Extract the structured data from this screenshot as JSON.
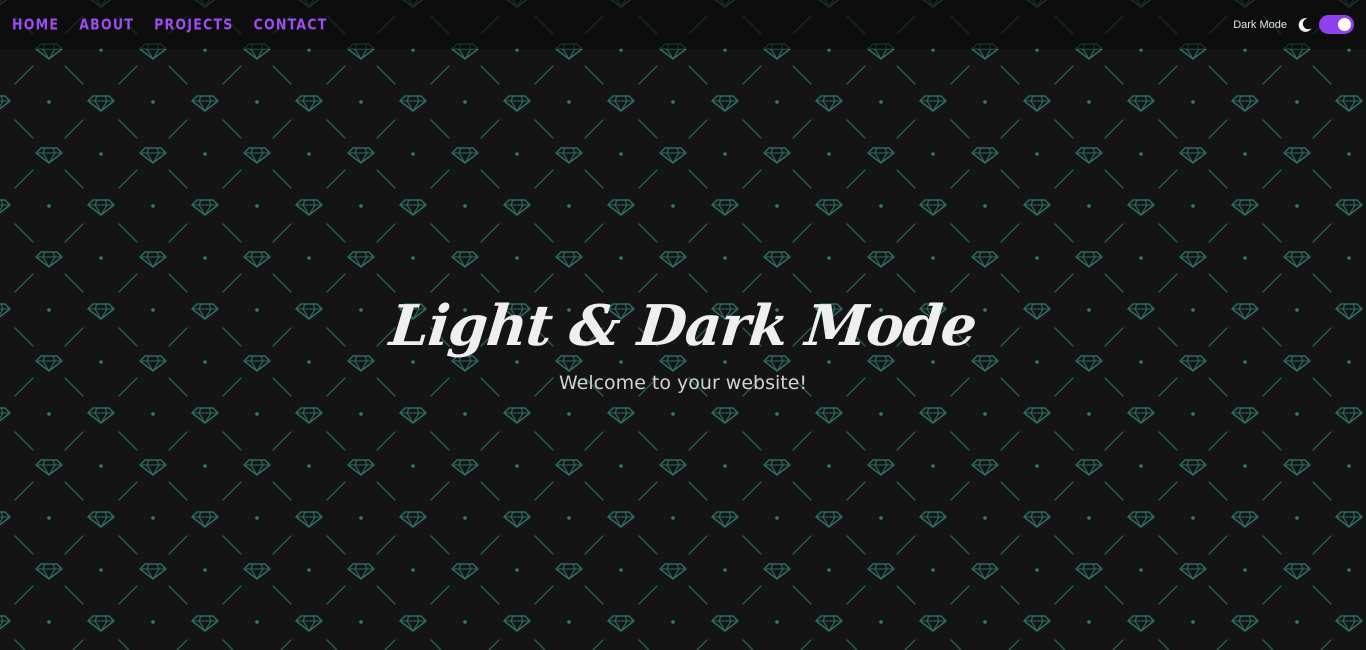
{
  "nav": {
    "items": [
      {
        "label": "HOME"
      },
      {
        "label": "ABOUT"
      },
      {
        "label": "PROJECTS"
      },
      {
        "label": "CONTACT"
      }
    ]
  },
  "theme_toggle": {
    "label": "Dark Mode",
    "icon": "moon-icon",
    "enabled": true
  },
  "hero": {
    "title": "Light & Dark Mode",
    "subtitle": "Welcome to your website!"
  },
  "colors": {
    "background": "#141414",
    "accent": "#9b4df0",
    "pattern": "#2a6e62",
    "title": "#efefef"
  }
}
